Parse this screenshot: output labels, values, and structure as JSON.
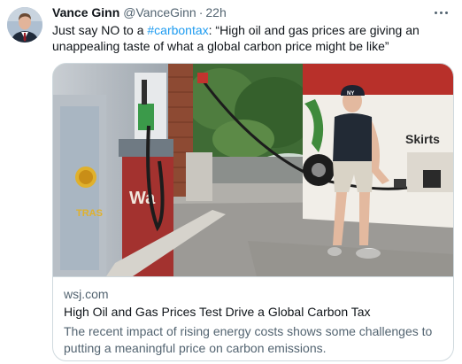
{
  "tweet": {
    "author_name": "Vance Ginn",
    "author_handle": "@VanceGinn",
    "separator": "·",
    "timestamp": "22h",
    "text_before": "Just say NO to a ",
    "hashtag": "#carbontax",
    "text_after": ": “High oil and gas prices are giving an unappealing taste of what a global carbon price might be like”"
  },
  "card": {
    "domain": "wsj.com",
    "headline": "High Oil and Gas Prices Test Drive a Global Carbon Tax",
    "description": "The recent impact of rising energy costs shows some challenges to putting a meaningful price on carbon emissions.",
    "photo_text": {
      "pump_brand": "TRAS",
      "station_sign": "Wa",
      "truck_brand": "Skirts",
      "hat_logo": "NY"
    }
  },
  "colors": {
    "link": "#1d9bf0",
    "secondary_text": "#536471",
    "border": "#cfd9de"
  },
  "icons": {
    "more": "more-horizontal-icon"
  }
}
